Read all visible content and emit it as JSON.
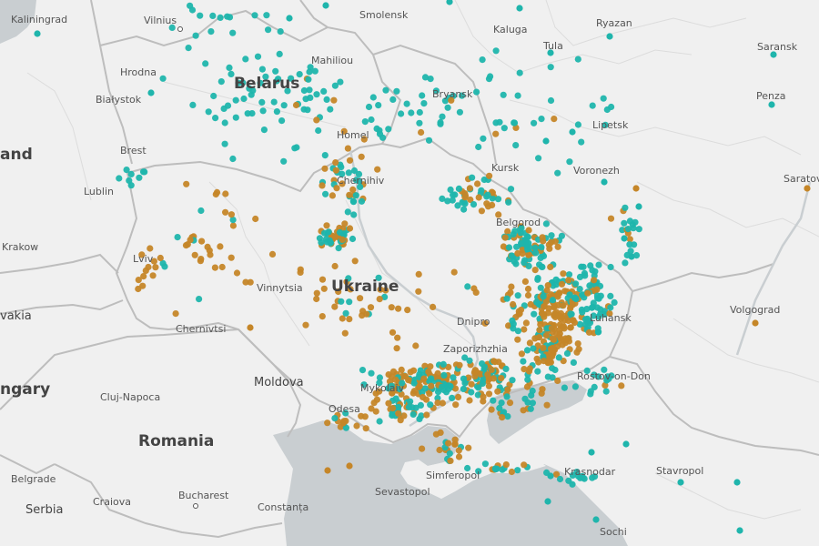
{
  "map": {
    "colors": {
      "land": "#f0f0f0",
      "sea": "#c9ced1",
      "border": "#bdbdbd",
      "region": "#dcdcdc",
      "teal": "#1fb5ac",
      "amber": "#c58628"
    },
    "countries": {
      "ukraine": "Ukraine",
      "belarus": "Belarus",
      "romania": "Romania",
      "moldova": "Moldova",
      "serbia": "Serbia",
      "hungary": "ngary",
      "poland": "and",
      "slovakia": "vakia"
    },
    "cities": {
      "kaliningrad": "Kaliningrad",
      "vilnius": "Vilnius",
      "smolensk": "Smolensk",
      "kaluga": "Kaluga",
      "ryazan": "Ryazan",
      "saransk": "Saransk",
      "tula": "Tula",
      "hrodna": "Hrodna",
      "mahiliou": "Mahiliou",
      "bialystok": "Białystok",
      "bryansk": "Bryansk",
      "lipetsk": "Lipetsk",
      "penza": "Penza",
      "brest": "Brest",
      "homel": "Homel",
      "kursk": "Kursk",
      "voronezh": "Voronezh",
      "saratov": "Saratov",
      "lublin": "Lublin",
      "chernihiv": "Chernihiv",
      "belgorod": "Belgorod",
      "krakow": "Krakow",
      "lviv": "Lviv",
      "vinnytsia": "Vinnytsia",
      "luhansk": "Luhansk",
      "volgograd": "Volgograd",
      "chernivtsi": "Chernivtsi",
      "dnipro": "Dnipro",
      "zaporizhzhia": "Zaporizhzhia",
      "rostov": "Rostov-on-Don",
      "mykolaiv": "Mykolaiv",
      "cluj": "Cluj-Napoca",
      "odesa": "Odesa",
      "belgrade": "Belgrade",
      "simferopol": "Simferopol",
      "krasnodar": "Krasnodar",
      "stavropol": "Stavropol",
      "craiova": "Craiova",
      "bucharest": "Bucharest",
      "sevastopol": "Sevastopol",
      "constanta": "Constanța",
      "sochi": "Sochi"
    }
  }
}
